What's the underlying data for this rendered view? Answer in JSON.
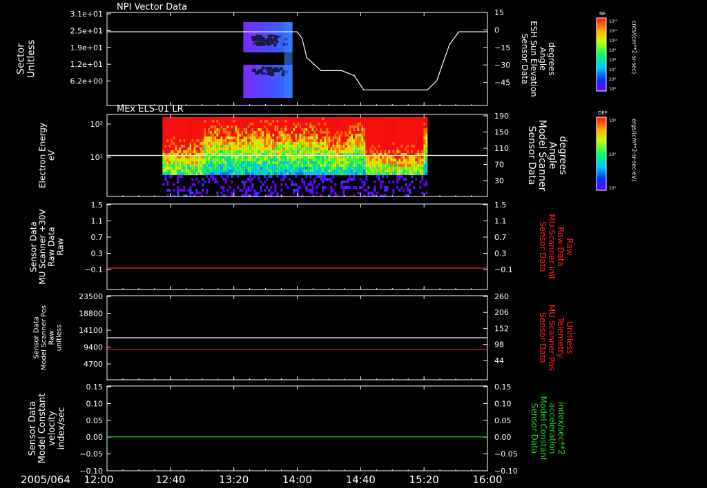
{
  "time_axis": {
    "date_label": "2005/064",
    "ticks": [
      "12:00",
      "12:40",
      "13:20",
      "14:00",
      "14:40",
      "15:20",
      "16:00"
    ]
  },
  "colors": {
    "axis": "#ffffff",
    "red_trace": "#ff2020",
    "green_trace": "#22dd22",
    "background": "#000000"
  },
  "colorbars": [
    {
      "tag": "NF",
      "unit": "cnts/(cm**2-sr-sec)",
      "tick_labels": [
        "10¹²",
        "10¹¹",
        "10¹⁰",
        "10⁹",
        "10⁸",
        "10⁷",
        "10⁶",
        "10⁵"
      ]
    },
    {
      "tag": "DEF",
      "unit": "ergs/(cm**2-sr-sec-eV)",
      "tick_labels": [
        "10⁴",
        "10²",
        "10⁰"
      ]
    }
  ],
  "chart_data": [
    {
      "type": "heatmap",
      "title": "NPI Vector Data",
      "ylabel": [
        "Sector",
        "Unitless"
      ],
      "yticks": [
        "3.1e+01",
        "2.5e+01",
        "1.9e+01",
        "1.2e+01",
        "6.2e+00"
      ],
      "ylabel_right": [
        "Sensor Data",
        "ESH Sun Elevation",
        "Angle",
        "degrees"
      ],
      "yticks_right": [
        "15",
        "0",
        "−15",
        "−30",
        "−45"
      ],
      "ylim_right": [
        -57,
        15
      ],
      "xlim": [
        "12:00",
        "16:00"
      ],
      "heatmap_span": [
        "13:26",
        "13:57"
      ],
      "series": [
        {
          "color": "white",
          "x": [
            "12:00",
            "14:00",
            "14:03",
            "14:06",
            "14:15",
            "14:22",
            "14:28",
            "14:36",
            "14:42",
            "15:22",
            "15:28",
            "15:36",
            "15:42",
            "16:00"
          ],
          "y": [
            0,
            0,
            -5,
            -20,
            -30,
            -30,
            -30,
            -34,
            -45,
            -45,
            -38,
            -10,
            0,
            0
          ]
        }
      ]
    },
    {
      "type": "heatmap",
      "title": "MEx ELS-01 LR",
      "ylabel": [
        "Electron Energy",
        "eV"
      ],
      "yticks": [
        "10²",
        "10¹"
      ],
      "ylim": [
        1,
        200
      ],
      "ylabel_right": [
        "Sensor Data",
        "Model Scanner",
        "Angle",
        "degrees"
      ],
      "yticks_right": [
        "190",
        "150",
        "110",
        "70",
        "30"
      ],
      "ylim_right": [
        0,
        190
      ],
      "xlim": [
        "12:00",
        "16:00"
      ],
      "heatmap_span": [
        "12:35",
        "15:22"
      ],
      "series": [
        {
          "color": "white",
          "x": [
            "12:00",
            "16:00"
          ],
          "y": [
            95,
            95
          ]
        }
      ]
    },
    {
      "type": "line",
      "ylabel": [
        "Sensor Data",
        "MU Scanner +30V",
        "Raw Data",
        "Raw"
      ],
      "yticks": [
        "1.5",
        "1.1",
        "0.7",
        "0.3",
        "−0.1"
      ],
      "ylim": [
        -0.5,
        1.5
      ],
      "ylabel_right": [
        "Sensor Data",
        "MU Scanner Init",
        "Raw Data",
        "Raw"
      ],
      "yticks_right": [
        "1.5",
        "1.1",
        "0.7",
        "0.3",
        "−0.1"
      ],
      "ylim_right": [
        -0.5,
        1.5
      ],
      "xlim": [
        "12:00",
        "16:00"
      ],
      "series": [
        {
          "color": "red",
          "axis": "left",
          "x": [
            "12:00",
            "16:00"
          ],
          "y": [
            0,
            0
          ]
        }
      ]
    },
    {
      "type": "line",
      "ylabel": [
        "Sensor Data",
        "Model Scanner Pos",
        "Raw",
        "unitless"
      ],
      "yticks": [
        "23500",
        "18800",
        "14100",
        "9400",
        "4700"
      ],
      "ylim": [
        0,
        23500
      ],
      "ylabel_right": [
        "Sensor Data",
        "MU Scanner Pos",
        "Telemetry",
        "Unitless"
      ],
      "yticks_right": [
        "260",
        "206",
        "152",
        "98",
        "44"
      ],
      "ylim_right": [
        -10,
        260
      ],
      "xlim": [
        "12:00",
        "16:00"
      ],
      "series": [
        {
          "color": "white",
          "axis": "left",
          "x": [
            "12:00",
            "16:00"
          ],
          "y": [
            11750,
            11750
          ]
        },
        {
          "color": "red",
          "axis": "right",
          "x": [
            "12:00",
            "16:00"
          ],
          "y": [
            88,
            88
          ]
        }
      ]
    },
    {
      "type": "line",
      "ylabel": [
        "Sensor Data",
        "Model Constant",
        "velocity",
        "index/sec"
      ],
      "yticks": [
        "0.15",
        "0.10",
        "0.05",
        "0.00",
        "−0.05",
        "−0.10"
      ],
      "ylim": [
        -0.1,
        0.15
      ],
      "ylabel_right": [
        "Sensor Data",
        "Model Constant",
        "acceleration",
        "index/sec**2"
      ],
      "yticks_right": [
        "0.15",
        "0.10",
        "0.05",
        "0.00",
        "−0.05",
        "−0.10"
      ],
      "ylim_right": [
        -0.1,
        0.15
      ],
      "xlim": [
        "12:00",
        "16:00"
      ],
      "series": [
        {
          "color": "green",
          "axis": "left",
          "x": [
            "12:00",
            "16:00"
          ],
          "y": [
            0,
            0
          ]
        }
      ]
    }
  ]
}
